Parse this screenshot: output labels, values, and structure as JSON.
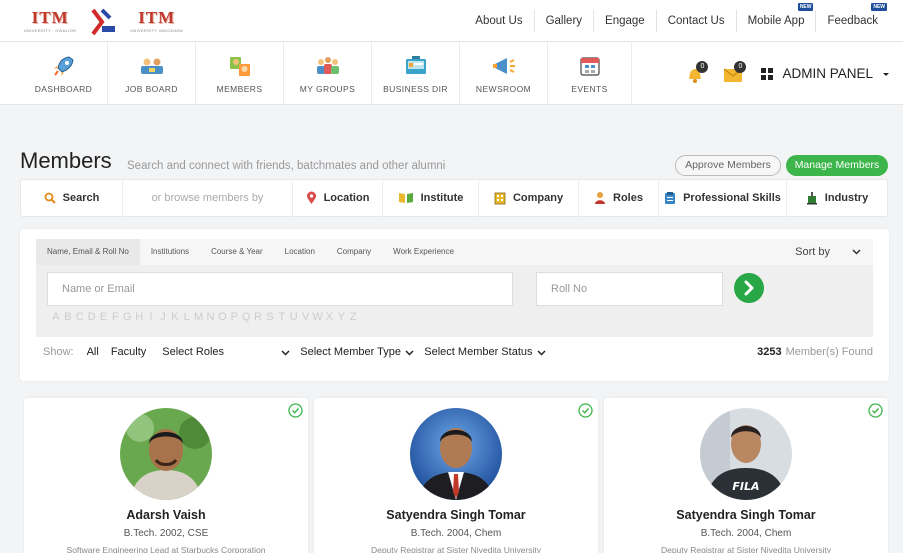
{
  "logos": [
    {
      "text": "ITM",
      "sub": "UNIVERSITY · GWALIOR"
    },
    {
      "text": "ITM",
      "sub": "UNIVERSITY VADODARA"
    }
  ],
  "top_links": [
    {
      "label": "About Us",
      "new": false
    },
    {
      "label": "Gallery",
      "new": false
    },
    {
      "label": "Engage",
      "new": false
    },
    {
      "label": "Contact Us",
      "new": false
    },
    {
      "label": "Mobile App",
      "new": true
    },
    {
      "label": "Feedback",
      "new": true
    }
  ],
  "new_badge": "NEW",
  "nav": [
    {
      "label": "DASHBOARD",
      "icon": "rocket-icon"
    },
    {
      "label": "JOB BOARD",
      "icon": "job-board-icon"
    },
    {
      "label": "MEMBERS",
      "icon": "members-icon"
    },
    {
      "label": "MY GROUPS",
      "icon": "groups-icon"
    },
    {
      "label": "BUSINESS DIR",
      "icon": "business-dir-icon"
    },
    {
      "label": "NEWSROOM",
      "icon": "megaphone-icon"
    },
    {
      "label": "EVENTS",
      "icon": "calendar-icon"
    }
  ],
  "notifications": {
    "bell_count": "0",
    "mail_count": "0"
  },
  "admin_panel": "ADMIN PANEL",
  "members": {
    "title": "Members",
    "subtitle": "Search and connect with friends, batchmates and other alumni",
    "approve_label": "Approve Members",
    "manage_label": "Manage Members"
  },
  "browse": {
    "search": "Search",
    "prompt": "or browse members by",
    "items": [
      {
        "label": "Location",
        "icon": "location-pin-icon"
      },
      {
        "label": "Institute",
        "icon": "book-icon"
      },
      {
        "label": "Company",
        "icon": "building-icon"
      },
      {
        "label": "Roles",
        "icon": "person-icon"
      },
      {
        "label": "Professional Skills",
        "icon": "clipboard-icon"
      },
      {
        "label": "Industry",
        "icon": "factory-icon"
      }
    ]
  },
  "filter": {
    "tabs": [
      "Name, Email & Roll No",
      "Institutions",
      "Course & Year",
      "Location",
      "Company",
      "Work Experience"
    ],
    "sort_label": "Sort by",
    "name_placeholder": "Name or Email",
    "roll_placeholder": "Roll No",
    "alphabet": [
      "A",
      "B",
      "C",
      "D",
      "E",
      "F",
      "G",
      "H",
      "I",
      "J",
      "K",
      "L",
      "M",
      "N",
      "O",
      "P",
      "Q",
      "R",
      "S",
      "T",
      "U",
      "V",
      "W",
      "X",
      "Y",
      "Z"
    ],
    "show_label": "Show:",
    "show_all": "All",
    "show_faculty": "Faculty",
    "select_roles": "Select Roles",
    "select_member_type": "Select Member Type",
    "select_member_status": "Select Member Status",
    "count": "3253",
    "found_label": "Member(s) Found"
  },
  "cards": [
    {
      "name": "Adarsh Vaish",
      "edu": "B.Tech. 2002, CSE",
      "job": "Software Engineering Lead at Starbucks Corporation"
    },
    {
      "name": "Satyendra Singh Tomar",
      "edu": "B.Tech. 2004, Chem",
      "job": "Deputy Registrar at Sister Nivedita University"
    },
    {
      "name": "Satyendra Singh Tomar",
      "edu": "B.Tech. 2004, Chem",
      "job": "Deputy Registrar at Sister Nivedita University"
    }
  ],
  "colors": {
    "accent_green": "#3cb54a",
    "brand_red": "#c0392b"
  }
}
